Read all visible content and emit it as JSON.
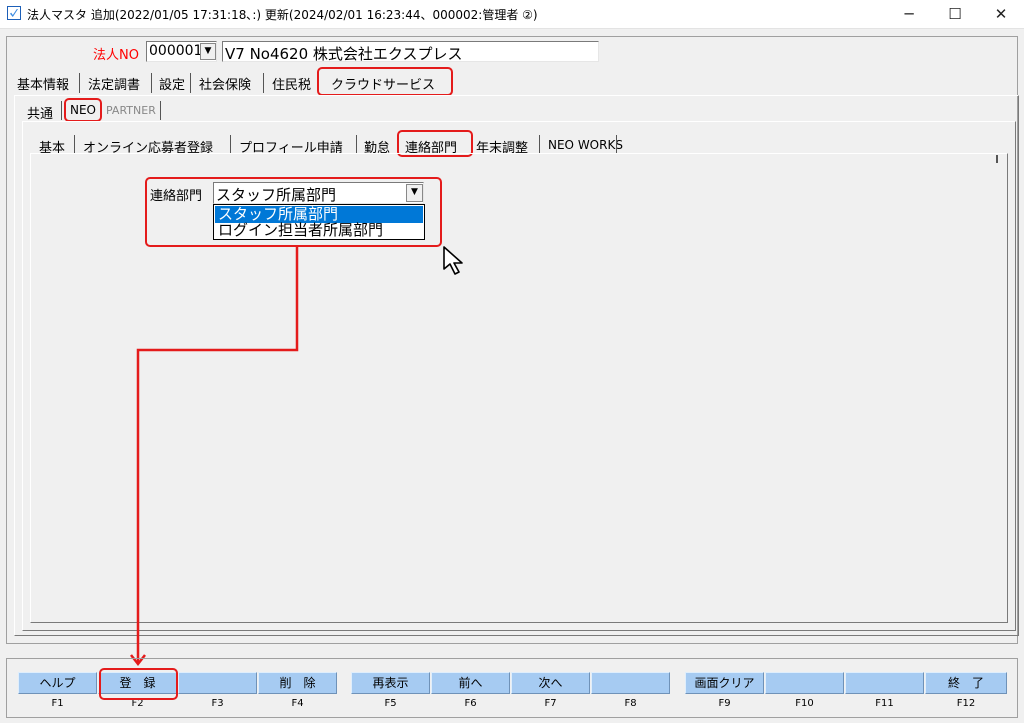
{
  "window": {
    "title": "法人マスタ 追加(2022/01/05 17:31:18､:) 更新(2024/02/01 16:23:44、000002:管理者 ②)",
    "minimize": "─",
    "maximize": "☐",
    "close": "✕"
  },
  "corp": {
    "label": "法人NO",
    "number": "000001",
    "name": "V7 No4620 株式会社エクスプレス"
  },
  "main_tabs": [
    "基本情報",
    "法定調書",
    "設定",
    "社会保険",
    "住民税",
    "クラウドサービス"
  ],
  "sub_tabs": [
    "共通",
    "NEO",
    "PARTNER"
  ],
  "inner_tabs": [
    "基本",
    "オンライン応募者登録",
    "プロフィール申請",
    "勤怠",
    "連絡部門",
    "年末調整",
    "NEO WORKS"
  ],
  "field": {
    "label": "連絡部門",
    "value": "スタッフ所属部門",
    "options": [
      "スタッフ所属部門",
      "ログイン担当者所属部門"
    ]
  },
  "fkeys": [
    {
      "label": "ヘルプ",
      "key": "F1"
    },
    {
      "label": "登　録",
      "key": "F2"
    },
    {
      "label": "",
      "key": "F3"
    },
    {
      "label": "削　除",
      "key": "F4"
    },
    {
      "label": "再表示",
      "key": "F5"
    },
    {
      "label": "前へ",
      "key": "F6"
    },
    {
      "label": "次へ",
      "key": "F7"
    },
    {
      "label": "",
      "key": "F8"
    },
    {
      "label": "画面クリア",
      "key": "F9"
    },
    {
      "label": "",
      "key": "F10"
    },
    {
      "label": "",
      "key": "F11"
    },
    {
      "label": "終　了",
      "key": "F12"
    }
  ],
  "colors": {
    "highlight": "#e41b1b",
    "selection": "#0078d7",
    "fkey": "#a6cbf2"
  }
}
